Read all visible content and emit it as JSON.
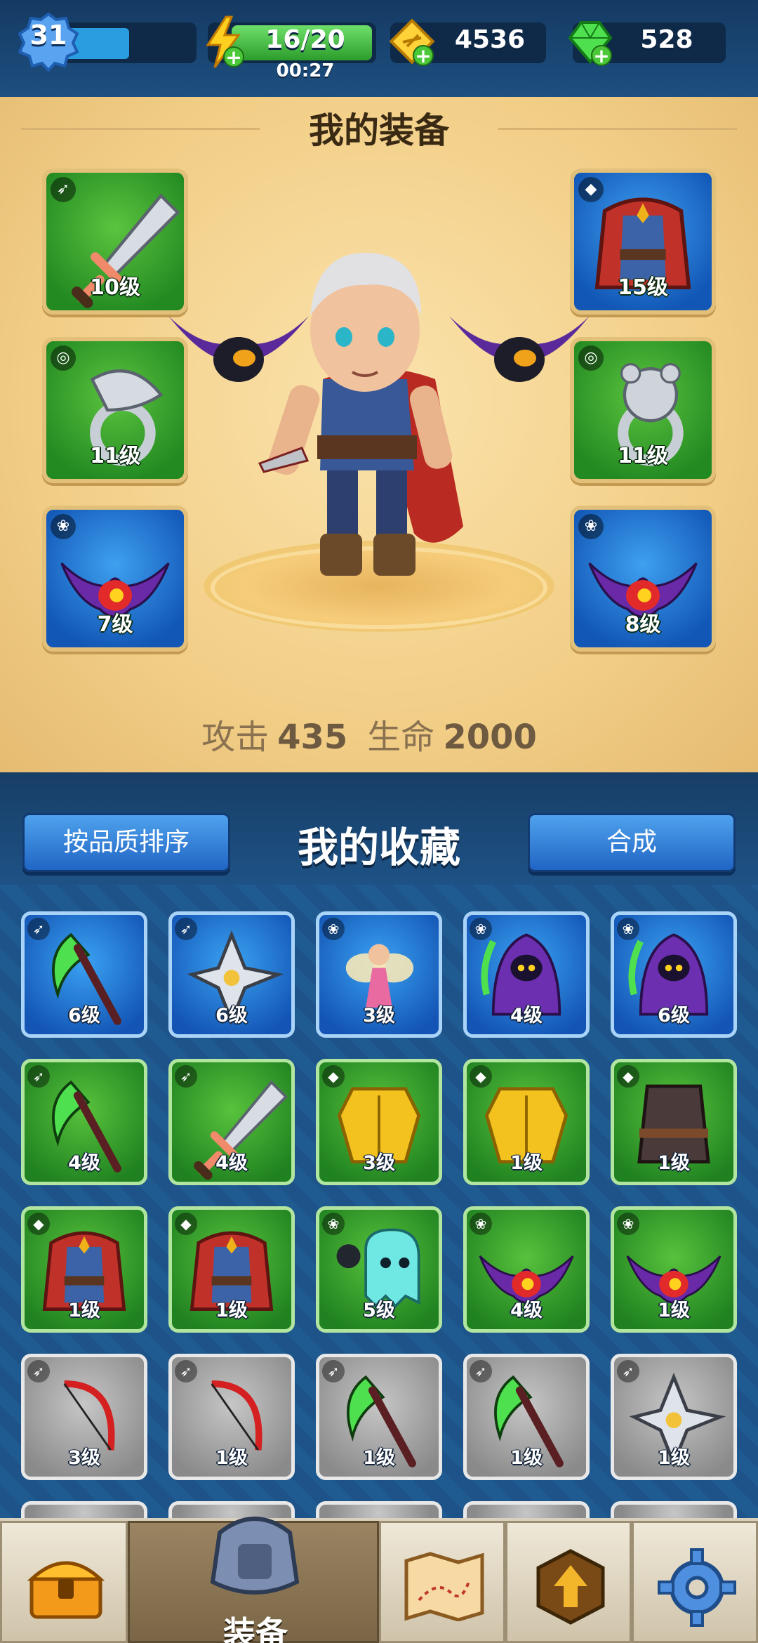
{
  "resources": {
    "player_level": "31",
    "energy": "16/20",
    "energy_timer": "00:27",
    "gold": "4536",
    "gems": "528",
    "xp_fraction": 0.55
  },
  "equipment": {
    "title": "我的装备",
    "left_slots": [
      {
        "type": "weapon",
        "rarity": "green",
        "level": "10级",
        "icon": "sword-icon"
      },
      {
        "type": "ring",
        "rarity": "green",
        "level": "11级",
        "icon": "eagle-ring-icon"
      },
      {
        "type": "pet",
        "rarity": "blue",
        "level": "7级",
        "icon": "bat-pet-icon"
      }
    ],
    "right_slots": [
      {
        "type": "armor",
        "rarity": "blue",
        "level": "15级",
        "icon": "red-cape-armor-icon"
      },
      {
        "type": "ring",
        "rarity": "green",
        "level": "11级",
        "icon": "bear-ring-icon"
      },
      {
        "type": "pet",
        "rarity": "blue",
        "level": "8级",
        "icon": "bat-pet-icon"
      }
    ],
    "stats": {
      "attack_label": "攻击",
      "attack_value": "435",
      "hp_label": "生命",
      "hp_value": "2000"
    }
  },
  "collection": {
    "title": "我的收藏",
    "sort_button": "按品质排序",
    "merge_button": "合成",
    "items": [
      {
        "rarity": "blue",
        "type": "weapon",
        "level": "6级",
        "icon": "scythe-icon"
      },
      {
        "rarity": "blue",
        "type": "weapon",
        "level": "6级",
        "icon": "shuriken-icon"
      },
      {
        "rarity": "blue",
        "type": "pet",
        "level": "3级",
        "icon": "fairy-icon"
      },
      {
        "rarity": "blue",
        "type": "pet",
        "level": "4级",
        "icon": "reaper-icon"
      },
      {
        "rarity": "blue",
        "type": "pet",
        "level": "6级",
        "icon": "reaper-icon"
      },
      {
        "rarity": "green",
        "type": "weapon",
        "level": "4级",
        "icon": "scythe-icon"
      },
      {
        "rarity": "green",
        "type": "weapon",
        "level": "4级",
        "icon": "sword-icon"
      },
      {
        "rarity": "green",
        "type": "armor",
        "level": "3级",
        "icon": "gold-armor-icon"
      },
      {
        "rarity": "green",
        "type": "armor",
        "level": "1级",
        "icon": "gold-armor-icon"
      },
      {
        "rarity": "green",
        "type": "armor",
        "level": "1级",
        "icon": "dark-vest-icon"
      },
      {
        "rarity": "green",
        "type": "armor",
        "level": "1级",
        "icon": "red-cape-armor-icon"
      },
      {
        "rarity": "green",
        "type": "armor",
        "level": "1级",
        "icon": "red-cape-armor-icon"
      },
      {
        "rarity": "green",
        "type": "pet",
        "level": "5级",
        "icon": "ghost-bomb-icon"
      },
      {
        "rarity": "green",
        "type": "pet",
        "level": "4级",
        "icon": "bat-pet-icon"
      },
      {
        "rarity": "green",
        "type": "pet",
        "level": "1级",
        "icon": "bat-pet-icon"
      },
      {
        "rarity": "gray",
        "type": "weapon",
        "level": "3级",
        "icon": "bow-icon"
      },
      {
        "rarity": "gray",
        "type": "weapon",
        "level": "1级",
        "icon": "bow-icon"
      },
      {
        "rarity": "gray",
        "type": "weapon",
        "level": "1级",
        "icon": "scythe-icon"
      },
      {
        "rarity": "gray",
        "type": "weapon",
        "level": "1级",
        "icon": "scythe-icon"
      },
      {
        "rarity": "gray",
        "type": "weapon",
        "level": "1级",
        "icon": "shuriken-icon"
      }
    ]
  },
  "nav": {
    "tabs": [
      {
        "name": "nav-chest",
        "icon": "treasure-chest-icon",
        "label": ""
      },
      {
        "name": "nav-equipment",
        "icon": "armor-helmet-icon",
        "label": "装备",
        "active": true
      },
      {
        "name": "nav-map",
        "icon": "map-icon",
        "label": ""
      },
      {
        "name": "nav-upgrade",
        "icon": "upgrade-arrow-icon",
        "label": ""
      },
      {
        "name": "nav-settings",
        "icon": "gear-icon",
        "label": ""
      }
    ]
  },
  "colors": {
    "panel_bg": "#f2cf88",
    "rarity_blue": "#1354b4",
    "rarity_green": "#1f8120",
    "rarity_gray": "#8a8a8a",
    "button_blue": "#2f7fd8"
  }
}
